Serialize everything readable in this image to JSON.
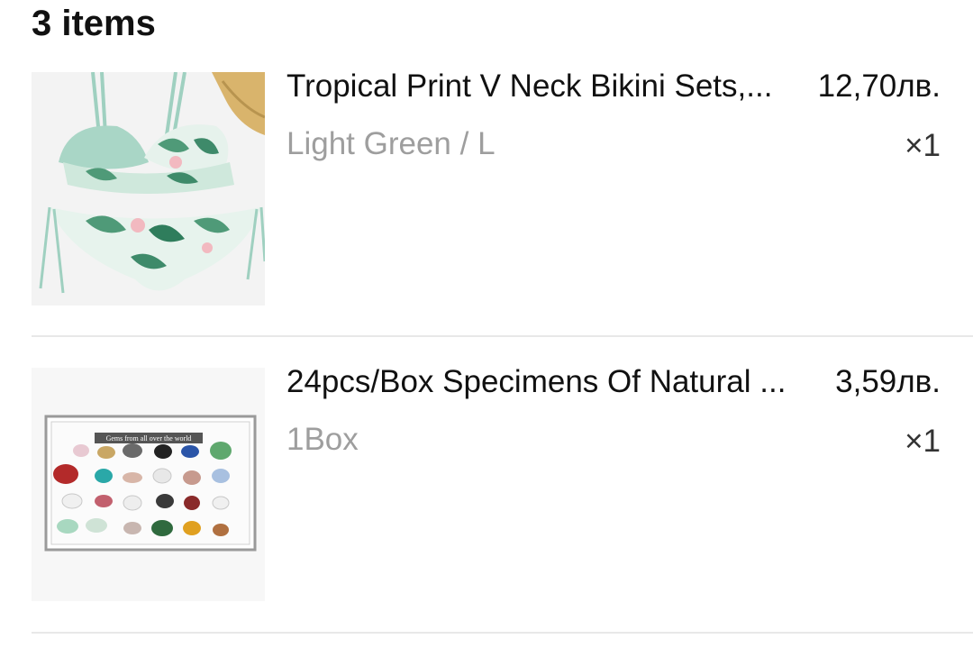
{
  "header": {
    "title": "3 items"
  },
  "items": [
    {
      "title": "Tropical Print V Neck Bikini Sets,...",
      "price": "12,70лв.",
      "variant": "Light Green / L",
      "quantity": "×1",
      "image": "bikini-product-image"
    },
    {
      "title": "24pcs/Box Specimens Of Natural ...",
      "price": "3,59лв.",
      "variant": "1Box",
      "quantity": "×1",
      "image": "gemstone-box-product-image",
      "image_text": "Gems from all over the world"
    }
  ]
}
